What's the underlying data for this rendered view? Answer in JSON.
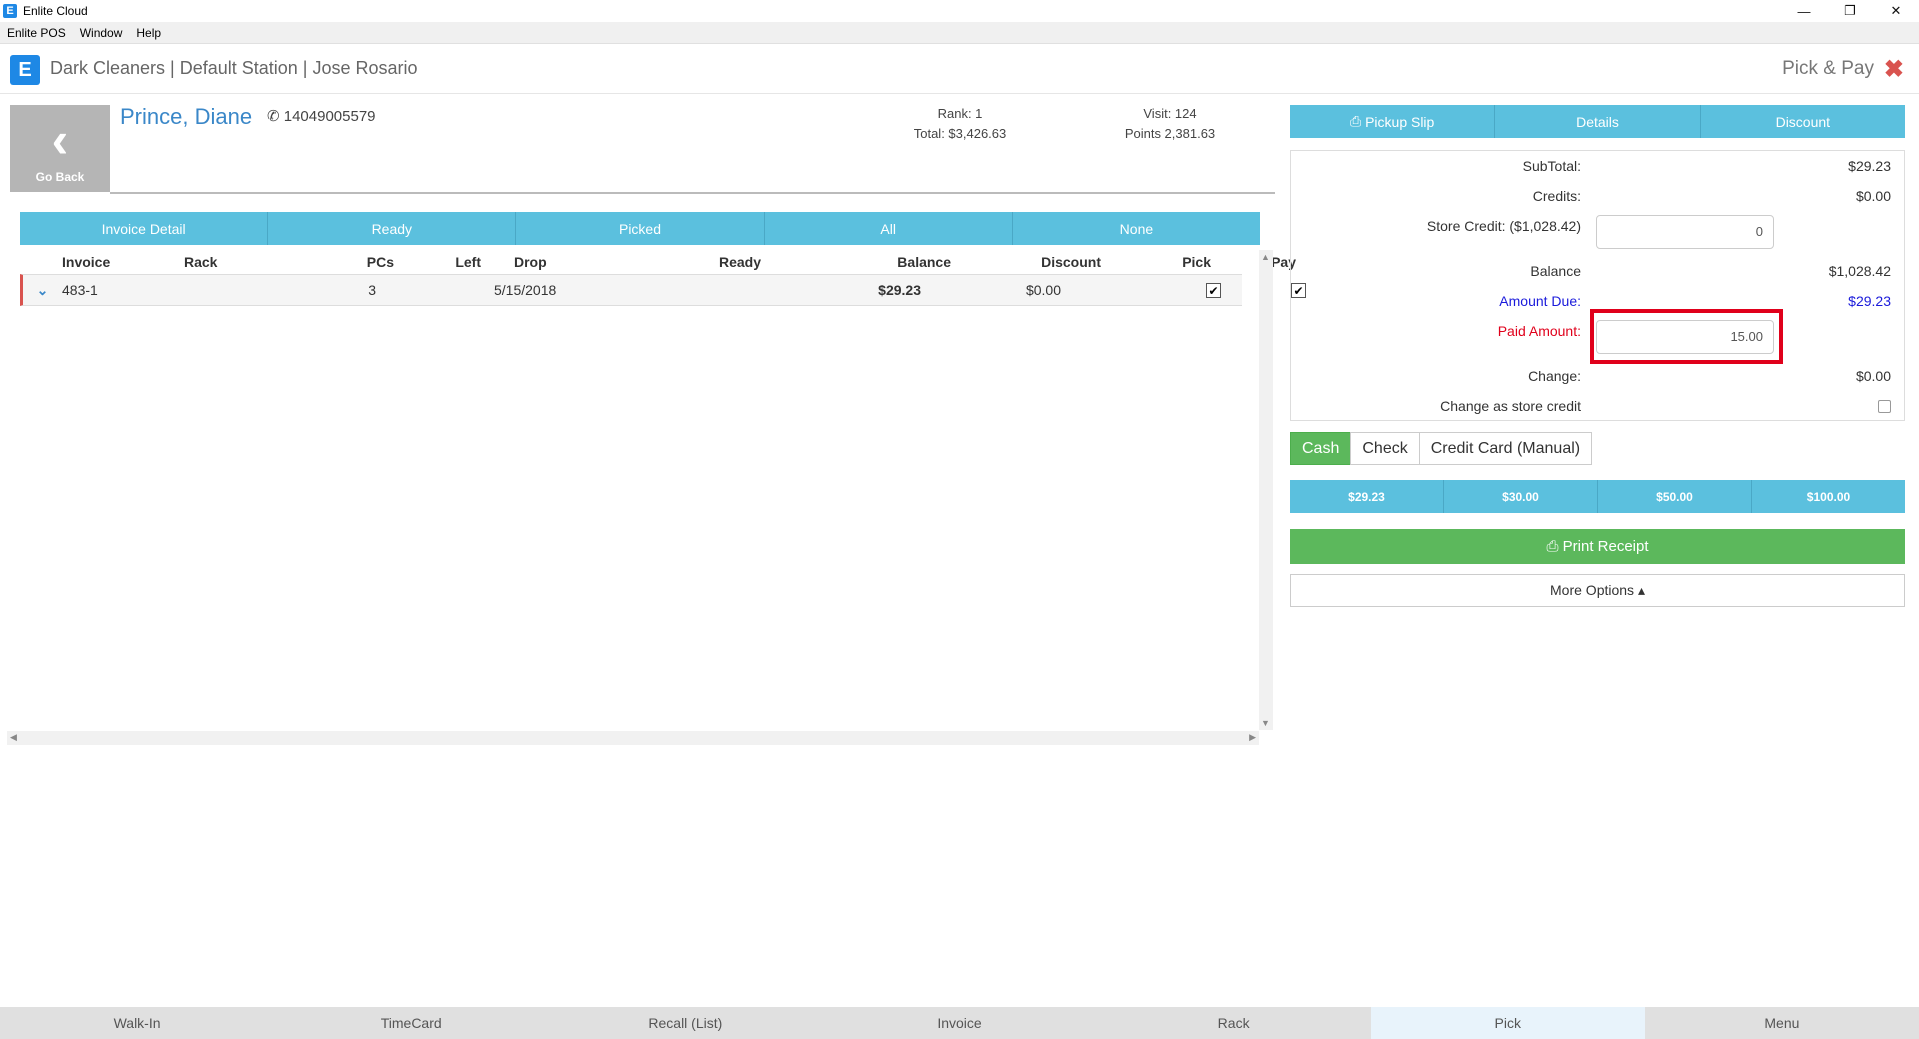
{
  "window": {
    "title": "Enlite Cloud",
    "icon_letter": "E",
    "minimize": "—",
    "maximize": "❐",
    "close": "✕"
  },
  "menu": [
    "Enlite POS",
    "Window",
    "Help"
  ],
  "header": {
    "store": "Dark Cleaners | Default Station | Jose Rosario",
    "screen_title": "Pick & Pay",
    "close": "✖"
  },
  "customer": {
    "go_back": "Go Back",
    "name": "Prince, Diane",
    "phone": "14049005579",
    "rank": "Rank: 1",
    "total": "Total: $3,426.63",
    "visit": "Visit: 124",
    "points": "Points 2,381.63"
  },
  "tabs": [
    "Invoice Detail",
    "Ready",
    "Picked",
    "All",
    "None"
  ],
  "table": {
    "columns": [
      "Invoice",
      "Rack",
      "PCs",
      "Left",
      "Drop",
      "Ready",
      "Balance",
      "Discount",
      "Pick",
      "Pay"
    ],
    "rows": [
      {
        "invoice": "483-1",
        "rack": "",
        "pcs": "3",
        "left": "",
        "drop": "5/15/2018",
        "ready": "",
        "balance": "$29.23",
        "discount": "$0.00",
        "pick": true,
        "pay": true
      }
    ]
  },
  "right_tabs": [
    "Pickup Slip",
    "Details",
    "Discount"
  ],
  "totals": {
    "subtotal_label": "SubTotal:",
    "subtotal": "$29.23",
    "credits_label": "Credits:",
    "credits": "$0.00",
    "store_credit_label": "Store Credit: ($1,028.42)",
    "store_credit_input": "0",
    "balance_label": "Balance",
    "balance": "$1,028.42",
    "amount_due_label": "Amount Due:",
    "amount_due": "$29.23",
    "paid_label": "Paid Amount:",
    "paid_input": "15.00",
    "change_label": "Change:",
    "change": "$0.00",
    "store_credit_change_label": "Change as store credit"
  },
  "payment_methods": [
    "Cash",
    "Check",
    "Credit Card (Manual)"
  ],
  "quick_amounts": [
    "$29.23",
    "$30.00",
    "$50.00",
    "$100.00"
  ],
  "print_receipt": "Print Receipt",
  "more_options": "More Options ▴",
  "footer": [
    "Walk-In",
    "TimeCard",
    "Recall (List)",
    "Invoice",
    "Rack",
    "Pick",
    "Menu"
  ],
  "colors": {
    "accent": "#5bc0de",
    "success": "#5cb85c",
    "danger": "#d9534f",
    "link": "#3a87c8",
    "due": "#1a1adb",
    "paid": "#e0001b"
  }
}
